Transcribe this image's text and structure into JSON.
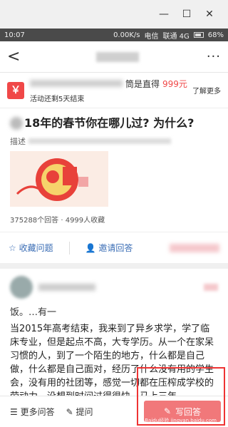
{
  "window": {
    "minimize": "—",
    "maximize": "☐",
    "close": "✕"
  },
  "status": {
    "time": "10:07",
    "speed": "0.00K/s",
    "carrier1": "电信",
    "carrier2": "联通 4G",
    "battery": "68%"
  },
  "appbar": {
    "back": "<",
    "more": "···"
  },
  "promo": {
    "icon": "￥",
    "headline_suffix": "筒是直得",
    "price": "999元",
    "countdown": "活动还剩5天结束",
    "learn_more": "了解更多"
  },
  "question": {
    "title": "18年的春节你在哪儿过? 为什么?",
    "desc_label": "描述",
    "stats": "375288个回答 · 4999人收藏"
  },
  "actions": {
    "collect": "收藏问题",
    "invite": "邀请回答"
  },
  "answer": {
    "short": "饭。…有一",
    "text": "当2015年高考结束，我来到了异乡求学，学了临床专业，但是起点不高，大专学历。从一个在家呆习惯的人，到了一个陌生的地方，什么都是自己做，什么都是自己面对，经历了什么没有用的学生会，没有用的社团等，感觉一切都在压榨成学校的劳动力，没想到时间过得很快，马上三年"
  },
  "bottom": {
    "more_answers": "更多问答",
    "ask": "提问",
    "write_answer": "写回答"
  },
  "watermark": "Baidu经验 jingyan.baidu.com"
}
